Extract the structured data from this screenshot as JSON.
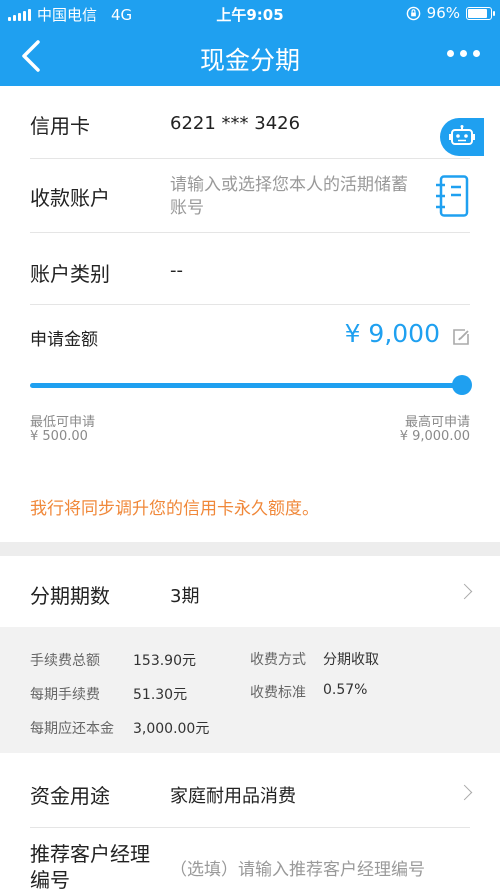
{
  "status": {
    "carrier": "中国电信",
    "network": "4G",
    "time": "上午9:05",
    "battery": "96%",
    "battery_level": 0.96
  },
  "nav": {
    "title": "现金分期"
  },
  "form": {
    "card": {
      "label": "信用卡",
      "value": "6221 *** 3426"
    },
    "account": {
      "label": "收款账户",
      "placeholder_line1": "请输入或选择您本人的活期储蓄",
      "placeholder_line2": "账号"
    },
    "account_type": {
      "label": "账户类别",
      "value": "--"
    },
    "amount": {
      "label": "申请金额",
      "value": "¥ 9,000",
      "slider_fraction": 1.0,
      "min_label": "最低可申请",
      "min_value": "¥ 500.00",
      "max_label": "最高可申请",
      "max_value": "¥ 9,000.00"
    },
    "notice": "我行将同步调升您的信用卡永久额度。",
    "term": {
      "label": "分期期数",
      "value": "3期"
    },
    "fees": {
      "total_fee_label": "手续费总额",
      "total_fee": "153.90元",
      "method_label": "收费方式",
      "method": "分期收取",
      "per_fee_label": "每期手续费",
      "per_fee": "51.30元",
      "rate_label": "收费标准",
      "rate": "0.57%",
      "principal_label": "每期应还本金",
      "principal": "3,000.00元"
    },
    "purpose": {
      "label": "资金用途",
      "value": "家庭耐用品消费"
    },
    "manager": {
      "label_line1": "推荐客户经理",
      "label_line2": "编号",
      "placeholder": "（选填）请输入推荐客户经理编号"
    }
  }
}
